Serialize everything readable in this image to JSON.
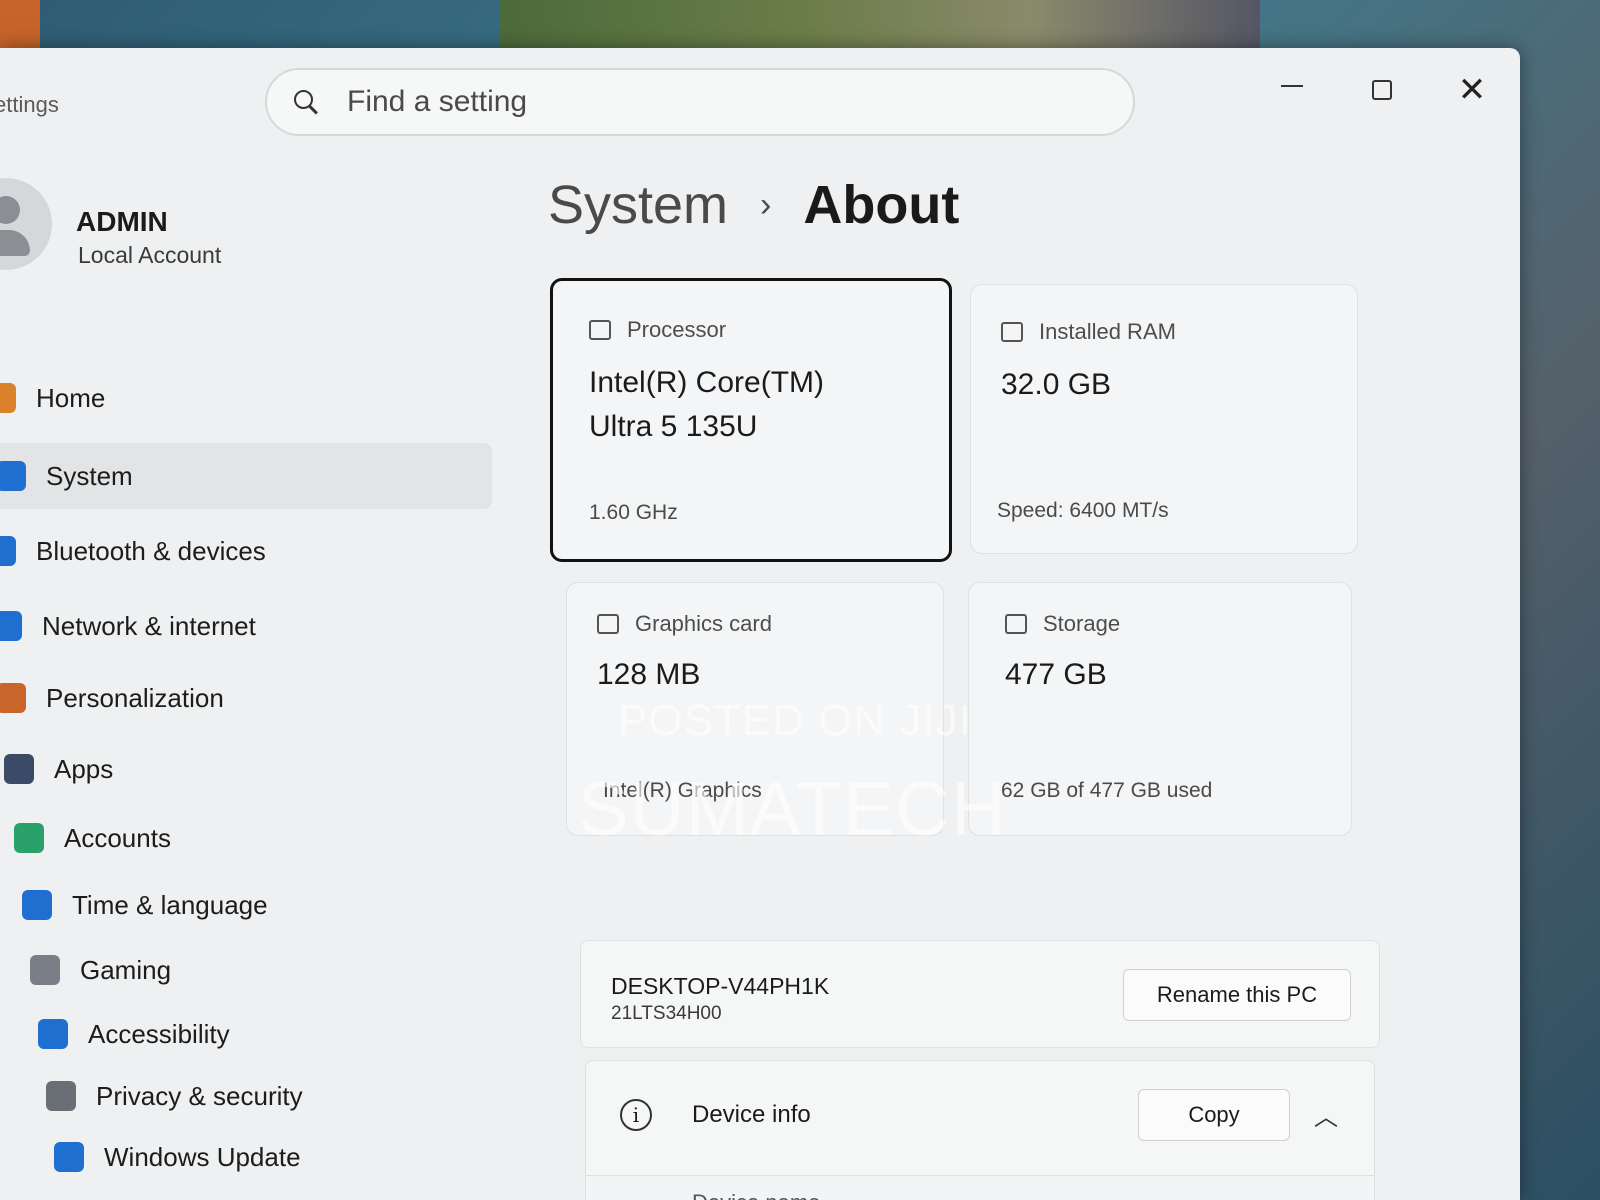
{
  "app": {
    "title": "ettings"
  },
  "search": {
    "placeholder": "Find a setting"
  },
  "window_controls": {
    "close_glyph": "✕"
  },
  "user": {
    "name": "ADMIN",
    "account_type": "Local Account"
  },
  "sidebar": {
    "items": [
      {
        "label": "Home",
        "icon": "home-icon",
        "color": "#d9822b"
      },
      {
        "label": "System",
        "icon": "system-icon",
        "color": "#1f6fd1",
        "active": true
      },
      {
        "label": "Bluetooth & devices",
        "icon": "bluetooth-icon",
        "color": "#1f6fd1"
      },
      {
        "label": "Network & internet",
        "icon": "wifi-icon",
        "color": "#1f6fd1"
      },
      {
        "label": "Personalization",
        "icon": "brush-icon",
        "color": "#c9642a"
      },
      {
        "label": "Apps",
        "icon": "apps-icon",
        "color": "#3b4a66"
      },
      {
        "label": "Accounts",
        "icon": "accounts-icon",
        "color": "#2aa06a"
      },
      {
        "label": "Time & language",
        "icon": "clock-globe-icon",
        "color": "#1f6fd1"
      },
      {
        "label": "Gaming",
        "icon": "gamepad-icon",
        "color": "#7a7f87"
      },
      {
        "label": "Accessibility",
        "icon": "accessibility-icon",
        "color": "#1f6fd1"
      },
      {
        "label": "Privacy & security",
        "icon": "shield-icon",
        "color": "#6a6e75"
      },
      {
        "label": "Windows Update",
        "icon": "update-icon",
        "color": "#1f6fd1"
      }
    ]
  },
  "breadcrumb": {
    "parent": "System",
    "separator": "›",
    "current": "About"
  },
  "specs": {
    "processor": {
      "label": "Processor",
      "value_line1": "Intel(R) Core(TM)",
      "value_line2": "Ultra 5 135U",
      "sub": "1.60 GHz"
    },
    "ram": {
      "label": "Installed RAM",
      "value": "32.0 GB",
      "sub": "Speed: 6400 MT/s"
    },
    "graphics": {
      "label": "Graphics card",
      "value": "128 MB",
      "sub": "Intel(R) Graphics"
    },
    "storage": {
      "label": "Storage",
      "value": "477 GB",
      "sub": "62 GB of 477 GB used"
    }
  },
  "device": {
    "name": "DESKTOP-V44PH1K",
    "model": "21LTS34H00",
    "rename_label": "Rename this PC"
  },
  "device_info": {
    "label": "Device info",
    "copy_label": "Copy",
    "next_label": "Device name"
  },
  "watermark": {
    "line1": "POSTED ON JIJI",
    "line2": "SUMATECH"
  }
}
